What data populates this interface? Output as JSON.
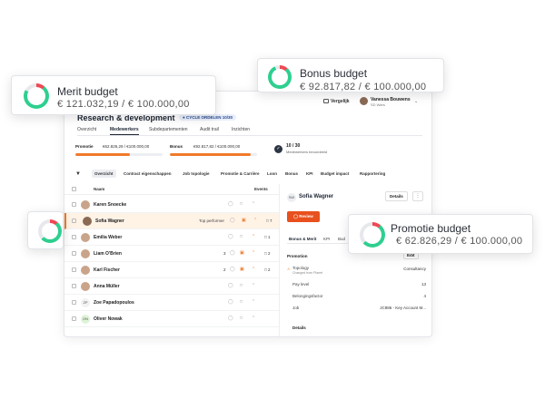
{
  "colors": {
    "accent": "#f07a2a",
    "ring_green": "#2ecf8f",
    "ring_red": "#ee4a55",
    "review": "#e8501d"
  },
  "header": {
    "compare_label": "Vergelijk",
    "user_name": "Vanessa Bouwens",
    "user_role": "SD Wars",
    "title": "Research & development",
    "cycle_badge": "● CYCLE ORDELEN 10/30"
  },
  "tabs": [
    "Overzicht",
    "Medewerkers",
    "Subdepartementen",
    "Audit trail",
    "Inzichten"
  ],
  "budgets": {
    "promotie_label": "Promotie",
    "promotie_value": "€62.826,29 / €100.000,00",
    "promotie_progress": 0.63,
    "bonus_label": "Bonus",
    "bonus_value": "€92.817,82 / €100.000,00",
    "bonus_progress": 0.93,
    "employees_count": "10 / 30",
    "employees_label": "Medewerkers beoordeeld"
  },
  "filters": [
    "Overzicht",
    "Contract eigenschappen",
    "Job topologie",
    "Promotie & Carrière",
    "Loon",
    "Bonus",
    "KPI",
    "Budget impact",
    "Rapportering"
  ],
  "list": {
    "col_name": "Naam",
    "col_events": "Events",
    "rows": [
      {
        "name": "Karen Snoecke",
        "tag": "",
        "num": "",
        "count": ""
      },
      {
        "name": "Sofia Wagner",
        "tag": "Top performer",
        "num": "",
        "count": "7"
      },
      {
        "name": "Emilia Weber",
        "tag": "",
        "num": "",
        "count": "1"
      },
      {
        "name": "Liam O'Brien",
        "tag": "",
        "num": "3",
        "count": "2"
      },
      {
        "name": "Karl Fischer",
        "tag": "",
        "num": "2",
        "count": "2"
      },
      {
        "name": "Anna Müller",
        "tag": "",
        "num": "",
        "count": ""
      },
      {
        "name": "Zoe Papadopoulos",
        "tag": "",
        "num": "",
        "count": ""
      },
      {
        "name": "Oliver Nowak",
        "tag": "",
        "num": "",
        "count": ""
      }
    ],
    "initials": [
      "",
      "",
      "",
      "",
      "",
      "",
      "ZP",
      "ON"
    ]
  },
  "panel": {
    "initials": "SW",
    "name": "Sofia Wagner",
    "details_label": "Details",
    "more_label": "⋮",
    "review_label": "Review",
    "tabs": [
      "Bonus & Merit",
      "KPI",
      "Bud"
    ],
    "section_title": "Promotion",
    "edit_label": "Edit",
    "rows": [
      {
        "key": "Topology",
        "sub": "Changed from Planet",
        "value": "Consultancy"
      },
      {
        "key": "Pay level",
        "sub": "",
        "value": "13"
      },
      {
        "key": "Belongingsfactor",
        "sub": "",
        "value": "4"
      },
      {
        "key": "Job",
        "sub": "",
        "value": "JC986 - Key Account M..."
      }
    ],
    "details_title": "Details"
  },
  "cards": {
    "merit_title": "Merit budget",
    "merit_value": "€ 121.032,19 / € 100.000,00",
    "merit_progress": 0.83,
    "bonus_title": "Bonus budget",
    "bonus_value": "€ 92.817,82 / € 100.000,00",
    "bonus_progress": 0.93,
    "promotie_title": "Promotie budget",
    "promotie_value": "€ 62.826,29 / € 100.000,00",
    "promotie_progress": 0.63
  }
}
